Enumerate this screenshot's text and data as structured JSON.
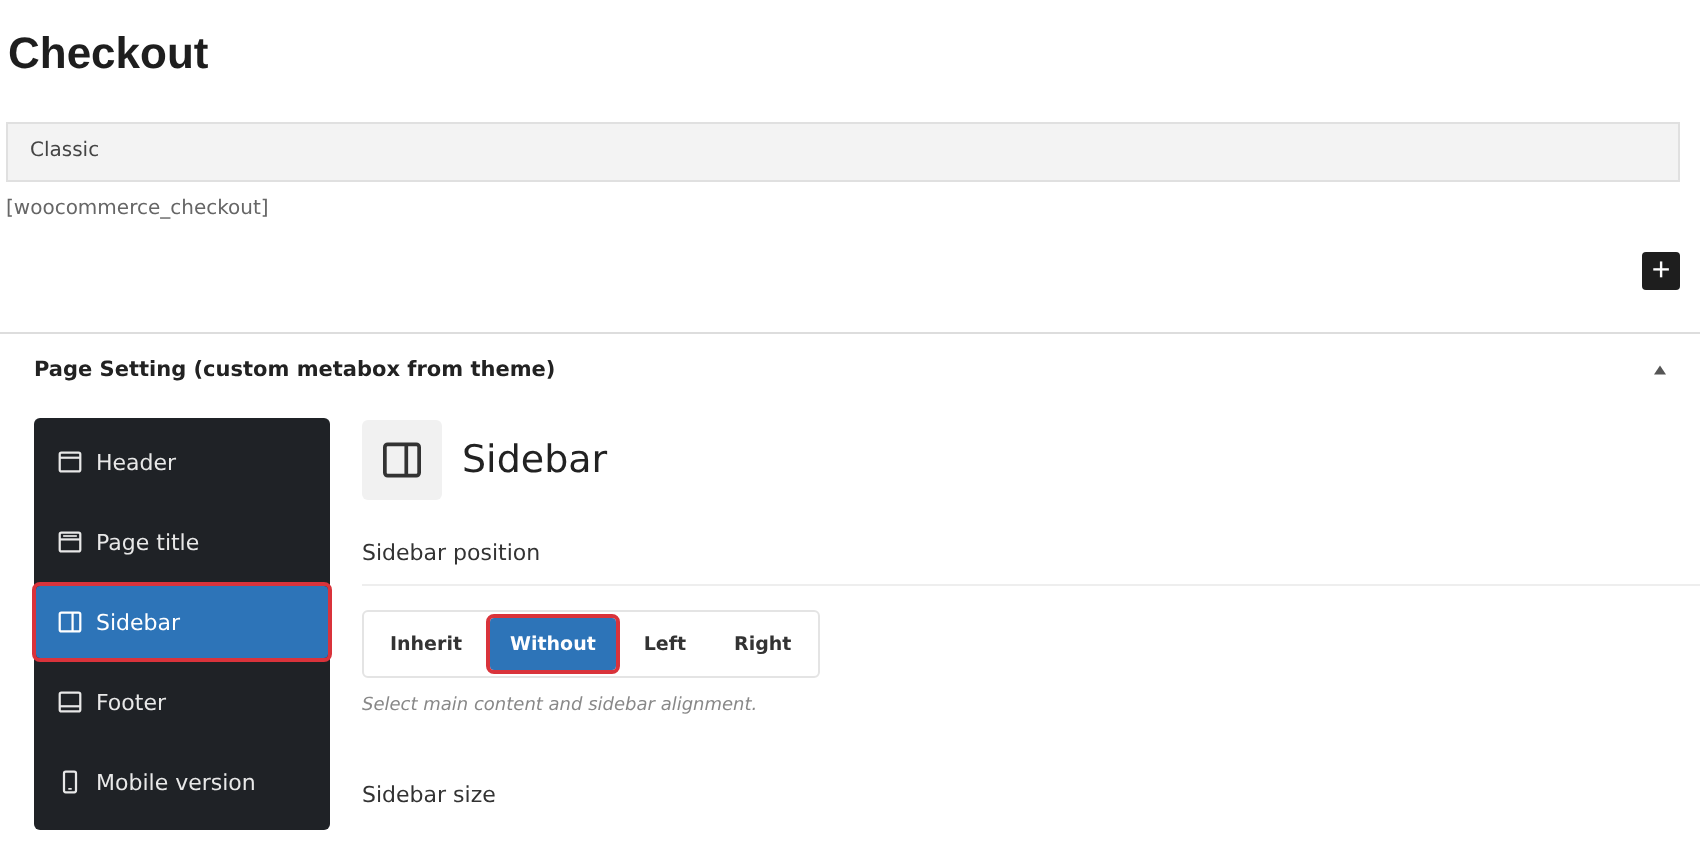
{
  "page_title": "Checkout",
  "template_field": {
    "value": "Classic"
  },
  "shortcode": "[woocommerce_checkout]",
  "add_block_button": "+",
  "metabox": {
    "title": "Page Setting (custom metabox from theme)",
    "expanded": true,
    "nav": [
      {
        "label": "Header",
        "kind": "header",
        "selected": false,
        "highlighted": false
      },
      {
        "label": "Page title",
        "kind": "page-title",
        "selected": false,
        "highlighted": false
      },
      {
        "label": "Sidebar",
        "kind": "sidebar",
        "selected": true,
        "highlighted": true
      },
      {
        "label": "Footer",
        "kind": "footer",
        "selected": false,
        "highlighted": false
      },
      {
        "label": "Mobile version",
        "kind": "mobile",
        "selected": false,
        "highlighted": false
      }
    ],
    "section_title": "Sidebar",
    "position_label": "Sidebar position",
    "position_options": [
      {
        "label": "Inherit",
        "selected": false,
        "highlighted": false
      },
      {
        "label": "Without",
        "selected": true,
        "highlighted": true
      },
      {
        "label": "Left",
        "selected": false,
        "highlighted": false
      },
      {
        "label": "Right",
        "selected": false,
        "highlighted": false
      }
    ],
    "position_hint": "Select main content and sidebar alignment.",
    "size_label": "Sidebar size"
  }
}
